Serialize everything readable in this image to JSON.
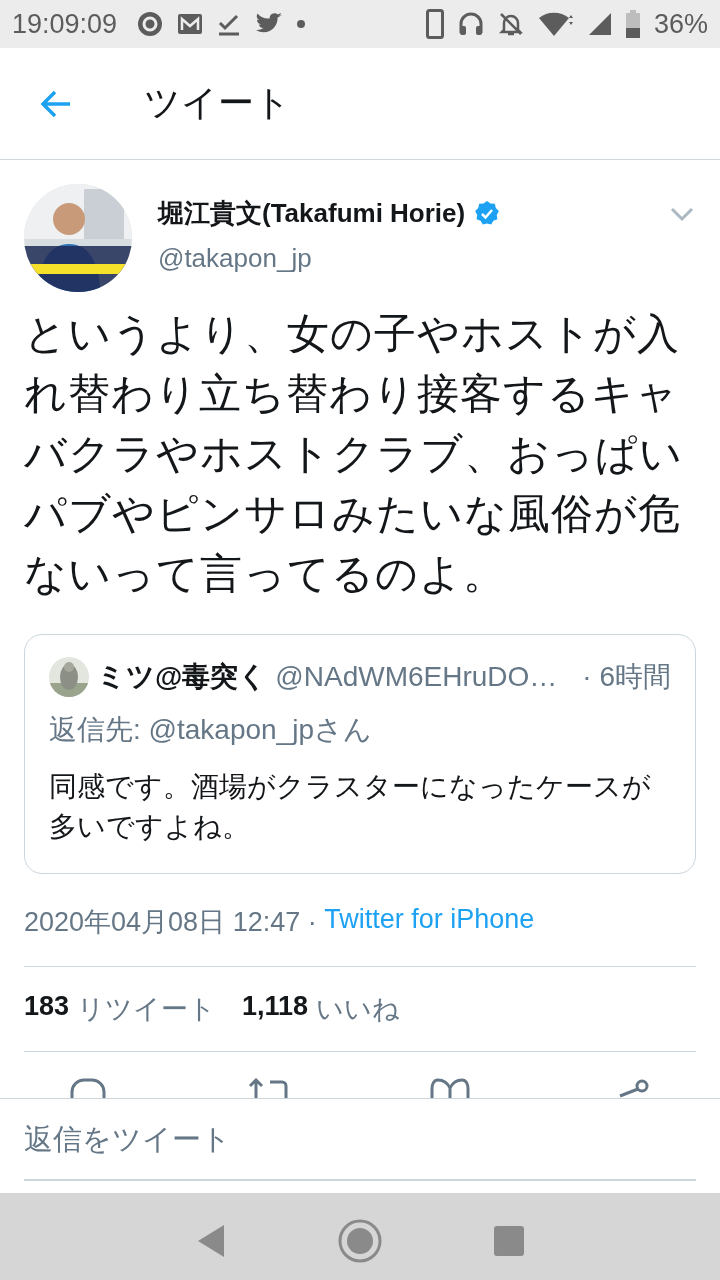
{
  "status_bar": {
    "time": "19:09:09",
    "battery": "36%"
  },
  "app_bar": {
    "title": "ツイート"
  },
  "tweet": {
    "author": "堀江貴文(Takafumi Horie)",
    "verified": true,
    "handle": "@takapon_jp",
    "text": "というより、女の子やホストが入れ替わり立ち替わり接客するキャバクラやホストクラブ、おっぱいパブやピンサロみたいな風俗が危ないって言ってるのよ。",
    "quote": {
      "author": "ミツ@毒突く",
      "handle": "@NAdWM6EHruDO…",
      "time": "· 6時間",
      "reply_to": "返信先: @takapon_jpさん",
      "text": "同感です。酒場がクラスターになったケースが多いですよね。"
    },
    "date": "2020年04月08日 12:47 · ",
    "source": "Twitter for iPhone",
    "stats": [
      {
        "count": "183",
        "label": "リツイート"
      },
      {
        "count": "1,118",
        "label": "いいね"
      }
    ]
  },
  "reply": {
    "placeholder": "返信をツイート"
  }
}
